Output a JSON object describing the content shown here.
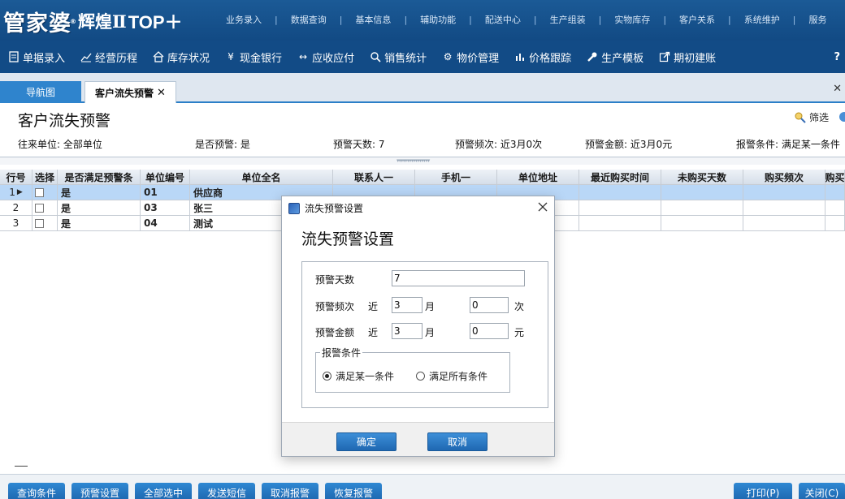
{
  "app": {
    "logo": {
      "brand": "管家婆",
      "reg": "®",
      "sub": "辉煌Ⅱ",
      "top": "TOP＋"
    },
    "top_menu": [
      "业务录入",
      "数据查询",
      "基本信息",
      "辅助功能",
      "配送中心",
      "生产组装",
      "实物库存",
      "客户关系",
      "系统维护",
      "服务"
    ]
  },
  "toolbar": {
    "items": [
      {
        "label": "单据录入",
        "icon": "document-icon"
      },
      {
        "label": "经营历程",
        "icon": "chart-line-icon"
      },
      {
        "label": "库存状况",
        "icon": "home-icon"
      },
      {
        "label": "现金银行",
        "icon": "yen-icon"
      },
      {
        "label": "应收应付",
        "icon": "arrows-icon"
      },
      {
        "label": "销售统计",
        "icon": "search-icon"
      },
      {
        "label": "物价管理",
        "icon": "gear-icon"
      },
      {
        "label": "价格跟踪",
        "icon": "bar-chart-icon"
      },
      {
        "label": "生产模板",
        "icon": "wrench-icon"
      },
      {
        "label": "期初建账",
        "icon": "external-icon"
      }
    ],
    "help": "?"
  },
  "tabs": {
    "nav": "导航图",
    "alert": "客户流失预警",
    "close_symbol": "✕"
  },
  "page": {
    "title": "客户流失预警",
    "filter_label": "筛选",
    "info": {
      "unit": "往来单位: 全部单位",
      "is_alert": "是否预警: 是",
      "days": "预警天数: 7",
      "freq": "预警频次: 近3月0次",
      "amount": "预警金额: 近3月0元",
      "condition": "报警条件: 满足某一条件"
    }
  },
  "grid": {
    "columns": [
      "行号",
      "选择",
      "是否满足预警条",
      "单位编号",
      "单位全名",
      "联系人一",
      "手机一",
      "单位地址",
      "最近购买时间",
      "未购买天数",
      "购买频次",
      "购买"
    ],
    "rows": [
      {
        "no": "1",
        "meets": "是",
        "code": "01",
        "name": "供应商",
        "selected": true
      },
      {
        "no": "2",
        "meets": "是",
        "code": "03",
        "name": "张三",
        "selected": false
      },
      {
        "no": "3",
        "meets": "是",
        "code": "04",
        "name": "测试",
        "selected": false
      }
    ]
  },
  "bottom_buttons": {
    "query": "查询条件",
    "settings": "预警设置",
    "select_all": "全部选中",
    "sms": "发送短信",
    "cancel_alert": "取消报警",
    "restore_alert": "恢复报警",
    "print": "打印(P)",
    "close": "关闭(C)"
  },
  "dialog": {
    "window_title": "流失预警设置",
    "heading": "流失预警设置",
    "days_label": "预警天数",
    "days_value": "7",
    "freq_label": "预警频次",
    "near": "近",
    "freq_months": "3",
    "month_unit": "月",
    "freq_count": "0",
    "count_unit": "次",
    "amount_label": "预警金额",
    "amount_months": "3",
    "amount_value": "0",
    "amount_unit": "元",
    "condition_group": "报警条件",
    "condition_any": "满足某一条件",
    "condition_all": "满足所有条件",
    "ok": "确定",
    "cancel": "取消"
  }
}
